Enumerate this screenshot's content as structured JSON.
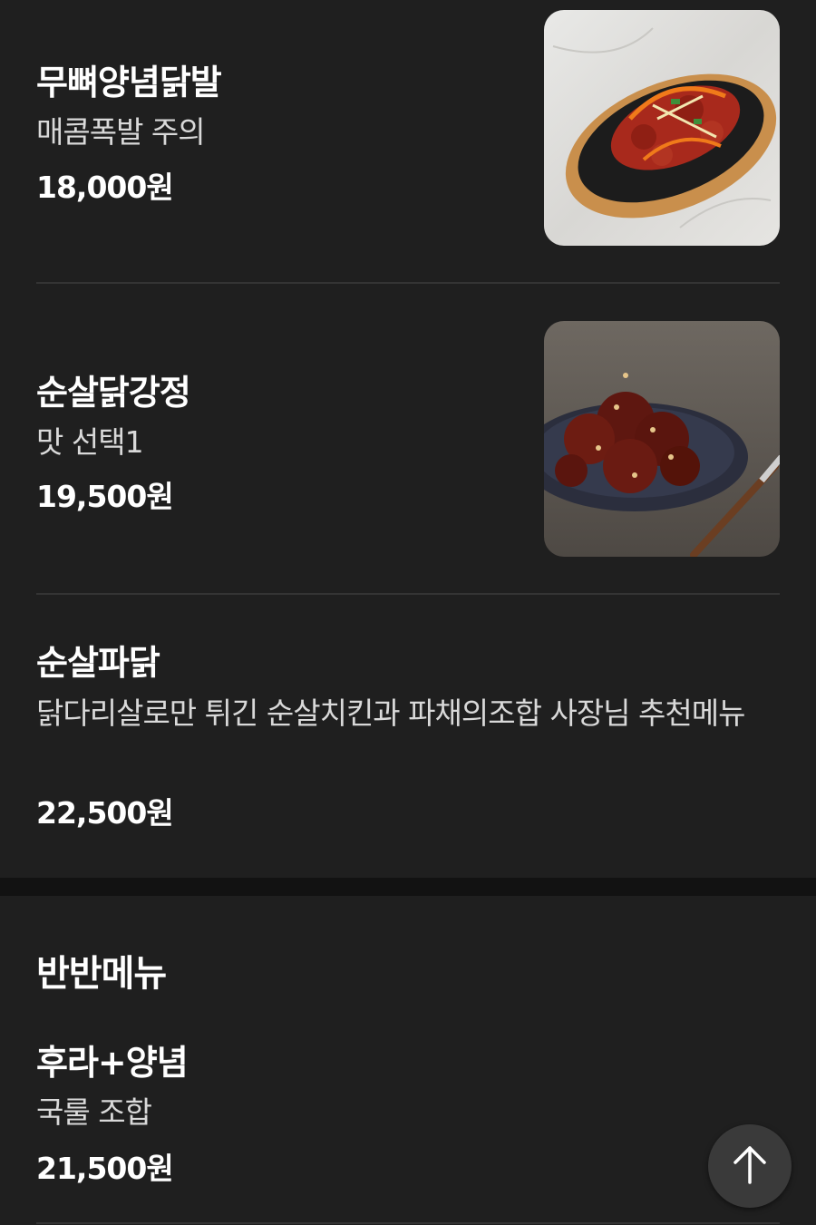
{
  "menu_items": [
    {
      "name": "무뼈양념닭발",
      "description": "매콤폭발 주의",
      "price": "18,000원",
      "image": "spicy-chicken-feet-photo"
    },
    {
      "name": "순살닭강정",
      "description": "맛 선택1",
      "price": "19,500원",
      "image": "boneless-dakgangjeong-photo"
    },
    {
      "name": "순살파닭",
      "description": "닭다리살로만 튀긴 순살치킨과 파채의조합 사장님 추천메뉴",
      "price": "22,500원"
    }
  ],
  "half_half_section": {
    "title": "반반메뉴",
    "items": [
      {
        "name": "후라+양념",
        "description": "국룰 조합",
        "price": "21,500원"
      }
    ]
  },
  "scroll_top_button": {
    "icon": "arrow-up-icon"
  },
  "colors": {
    "background": "#1f1f1f",
    "divider": "#343434",
    "section_gap": "#121212",
    "button": "#3a3a3a"
  }
}
